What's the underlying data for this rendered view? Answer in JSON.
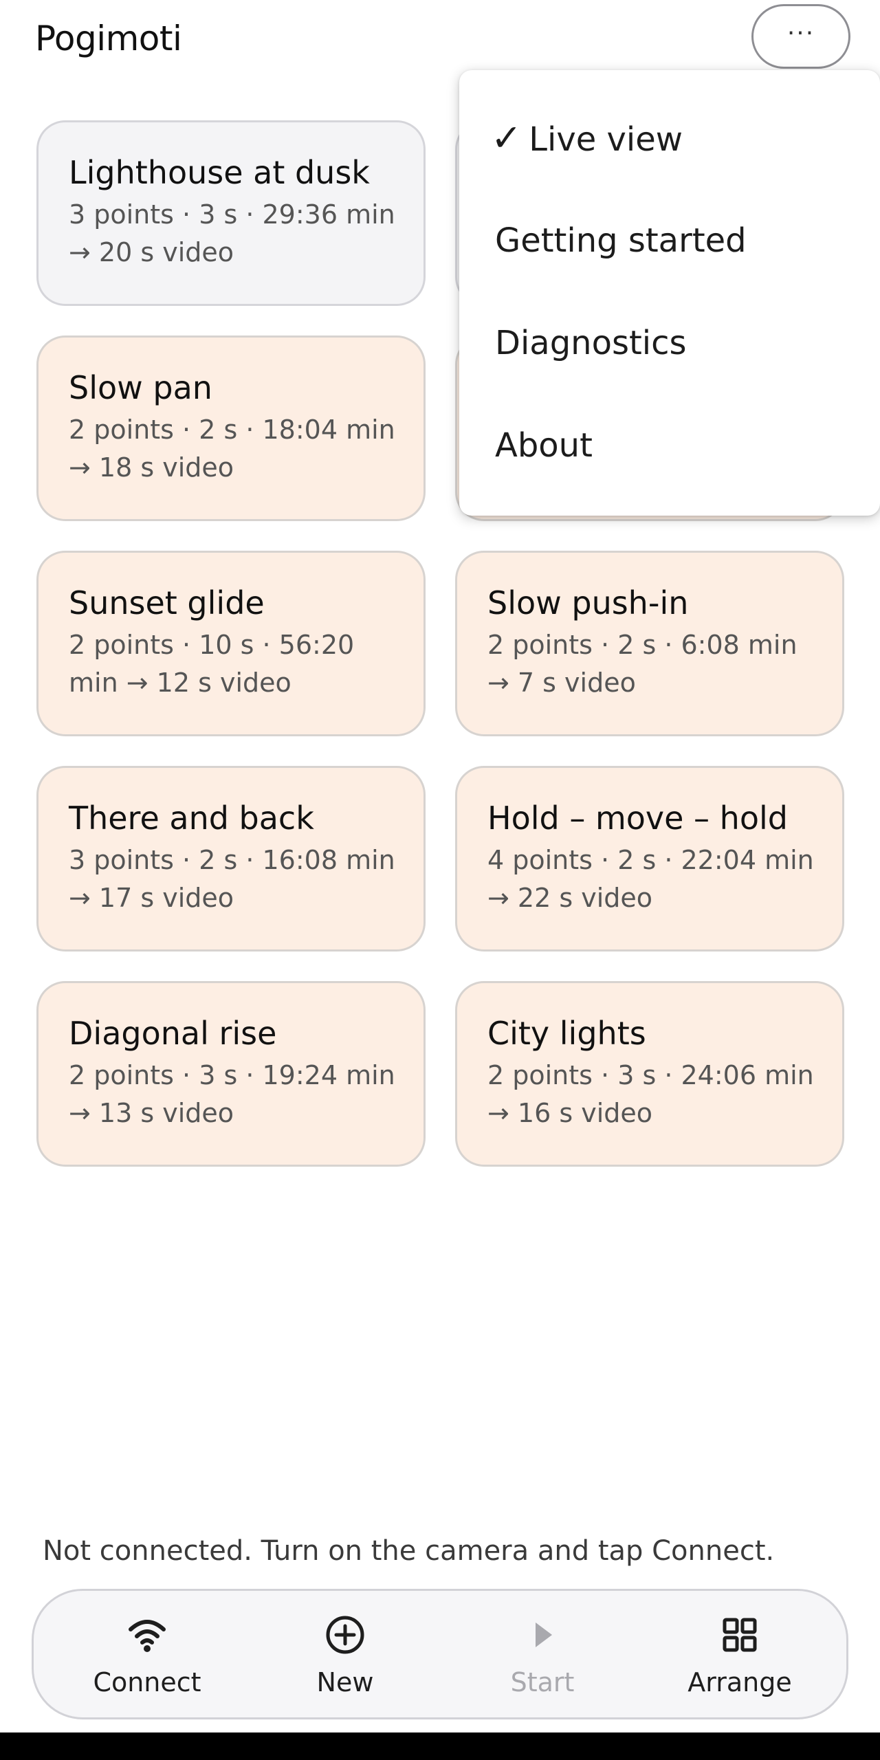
{
  "app": {
    "title": "Pogimoti",
    "menu_button_label": "···"
  },
  "cards": [
    {
      "title": "Lighthouse at dusk",
      "meta": "3 points · 3 s · 29:36 min → 20 s video",
      "style": "neutral"
    },
    {
      "title": "",
      "meta": "",
      "style": "neutral"
    },
    {
      "title": "Slow pan",
      "meta": "2 points · 2 s · 18:04 min → 18 s video",
      "style": "peach"
    },
    {
      "title": "",
      "meta": "",
      "style": "peach"
    },
    {
      "title": "Sunset glide",
      "meta": "2 points · 10 s · 56:20 min → 12 s video",
      "style": "peach"
    },
    {
      "title": "Slow push-in",
      "meta": "2 points · 2 s · 6:08 min → 7 s video",
      "style": "peach"
    },
    {
      "title": "There and back",
      "meta": "3 points · 2 s · 16:08 min → 17 s video",
      "style": "peach"
    },
    {
      "title": "Hold – move – hold",
      "meta": "4 points · 2 s · 22:04 min → 22 s video",
      "style": "peach"
    },
    {
      "title": "Diagonal rise",
      "meta": "2 points · 3 s · 19:24 min → 13 s video",
      "style": "peach"
    },
    {
      "title": "City lights",
      "meta": "2 points · 3 s · 24:06 min → 16 s video",
      "style": "peach"
    }
  ],
  "menu": {
    "items": [
      {
        "label": "Live view",
        "checked": true,
        "check_glyph": "✓"
      },
      {
        "label": "Getting started",
        "checked": false
      },
      {
        "label": "Diagnostics",
        "checked": false
      },
      {
        "label": "About",
        "checked": false
      }
    ]
  },
  "status": {
    "text": "Not connected. Turn on the camera and tap Connect."
  },
  "toolbar": {
    "connect_label": "Connect",
    "new_label": "New",
    "start_label": "Start",
    "arrange_label": "Arrange"
  },
  "colors": {
    "card_peach": "#fdeee3",
    "card_neutral": "#f4f4f6",
    "disabled": "#a9a9ae",
    "text_primary": "#111111",
    "text_secondary": "#555555"
  },
  "icons": {
    "menu": "more-horizontal-icon",
    "connect": "wifi-icon",
    "new": "plus-circle-icon",
    "start": "play-icon",
    "arrange": "grid-icon"
  }
}
